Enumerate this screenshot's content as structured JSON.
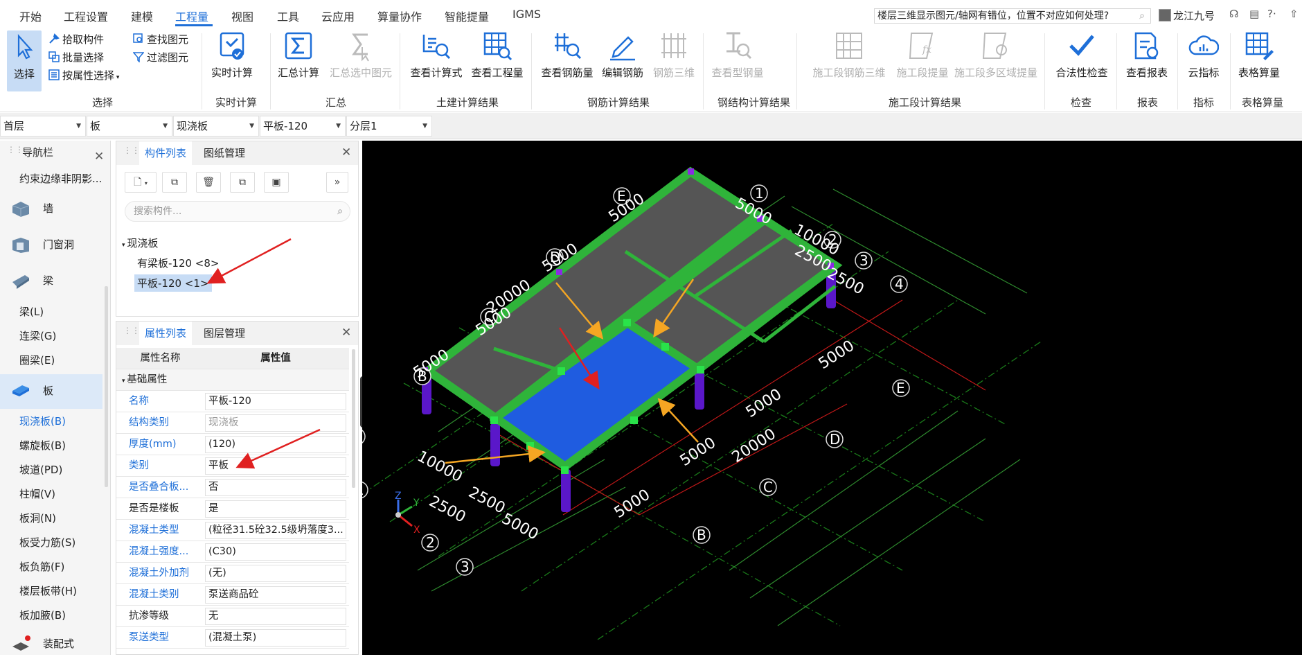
{
  "menu": {
    "items": [
      "开始",
      "工程设置",
      "建模",
      "工程量",
      "视图",
      "工具",
      "云应用",
      "算量协作",
      "智能提量",
      "IGMS"
    ],
    "active": "工程量",
    "help_search": "楼层三维显示图元/轴网有错位，位置不对应如何处理?",
    "user": "龙江九号",
    "help_icon": "?·"
  },
  "ribbon": {
    "select": {
      "label": "选择",
      "pick": "拾取构件",
      "batch": "批量选择",
      "by_attr": "按属性选择",
      "find": "查找图元",
      "filter": "过滤图元",
      "group": "选择"
    },
    "realtime": {
      "label": "实时计算",
      "group": "实时计算"
    },
    "summary": {
      "calc": "汇总计算",
      "calc_sel": "汇总选中图元",
      "group": "汇总"
    },
    "civil": {
      "formula": "查看计算式",
      "quantity": "查看工程量",
      "group": "土建计算结果"
    },
    "rebar": {
      "view": "查看钢筋量",
      "edit": "编辑钢筋",
      "rebar3d": "钢筋三维",
      "group": "钢筋计算结果"
    },
    "steel": {
      "view": "查看型钢量",
      "group": "钢结构计算结果"
    },
    "stage": {
      "rebar3d": "施工段钢筋三维",
      "extract": "施工段提量",
      "multi": "施工段多区域提量",
      "group": "施工段计算结果"
    },
    "check": {
      "legal": "合法性检查",
      "group": "检查"
    },
    "report": {
      "view": "查看报表",
      "group": "报表"
    },
    "index": {
      "cloud": "云指标",
      "group": "指标"
    },
    "table": {
      "calc": "表格算量",
      "group": "表格算量"
    }
  },
  "filters": {
    "floor": "首层",
    "type": "板",
    "subtype": "现浇板",
    "component": "平板-120",
    "layer": "分层1"
  },
  "nav": {
    "title": "导航栏",
    "top_item": "约束边缘非阴影...",
    "categories": [
      "墙",
      "门窗洞",
      "梁"
    ],
    "beam_subs": [
      "梁(L)",
      "连梁(G)",
      "圈梁(E)"
    ],
    "slab": "板",
    "slab_subs": [
      "现浇板(B)",
      "螺旋板(B)",
      "坡道(PD)",
      "柱帽(V)",
      "板洞(N)",
      "板受力筋(S)",
      "板负筋(F)",
      "楼层板带(H)",
      "板加腋(B)"
    ],
    "assembly": "装配式"
  },
  "component_panel": {
    "tab_list": "构件列表",
    "tab_drawing": "图纸管理",
    "search_placeholder": "搜索构件...",
    "tree_root": "现浇板",
    "items": [
      "有梁板-120 <8>",
      "平板-120 <1>"
    ]
  },
  "property_panel": {
    "tab_props": "属性列表",
    "tab_layers": "图层管理",
    "header_name": "属性名称",
    "header_value": "属性值",
    "group": "基础属性",
    "rows": [
      {
        "name": "名称",
        "value": "平板-120"
      },
      {
        "name": "结构类别",
        "value": "现浇板"
      },
      {
        "name": "厚度(mm)",
        "value": "(120)"
      },
      {
        "name": "类别",
        "value": "平板"
      },
      {
        "name": "是否叠合板...",
        "value": "否"
      },
      {
        "name": "是否是楼板",
        "value": "是"
      },
      {
        "name": "混凝土类型",
        "value": "(粒径31.5砼32.5级坍落度3..."
      },
      {
        "name": "混凝土强度...",
        "value": "(C30)"
      },
      {
        "name": "混凝土外加剂",
        "value": "(无)"
      },
      {
        "name": "混凝土类别",
        "value": "泵送商品砼"
      },
      {
        "name": "抗渗等级",
        "value": "无"
      },
      {
        "name": "泵送类型",
        "value": "(混凝土泵)"
      }
    ]
  },
  "viewport": {
    "axes_letters": [
      "E",
      "D",
      "C",
      "B",
      "A"
    ],
    "axes_numbers": [
      "1",
      "2",
      "3",
      "4"
    ],
    "dims": [
      "5000",
      "5000",
      "10000",
      "2500",
      "2500",
      "20000",
      "5000",
      "5000",
      "5000",
      "5000",
      "5000",
      "5000",
      "20000",
      "5000",
      "10000",
      "2500",
      "2500",
      "5000",
      "5000"
    ],
    "triad": [
      "Z",
      "Y",
      "X"
    ],
    "colors": {
      "beam": "#2fb43a",
      "slab": "#555555",
      "selected_slab": "#1f5ce0",
      "column": "#5a17c9",
      "axis": "#1a7a1a",
      "dim": "#2e8b2e",
      "red_arrow": "#e02020",
      "orange_arrow": "#f5a623"
    }
  }
}
